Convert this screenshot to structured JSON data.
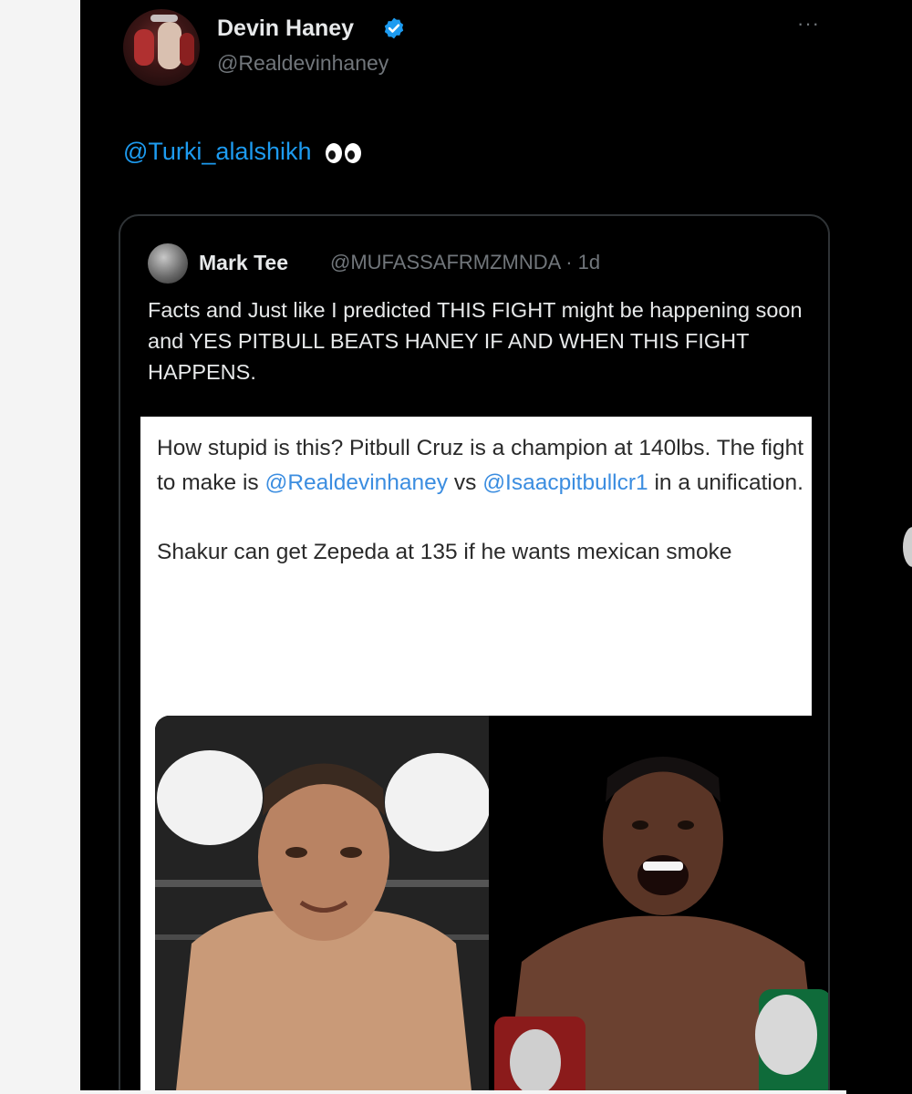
{
  "tweet": {
    "display_name": "Devin Haney",
    "handle": "@Realdevinhaney",
    "more_label": "···",
    "mention": "@Turki_alalshikh",
    "emoji_icon": "eyes-emoji"
  },
  "quote": {
    "name": "Mark Tee",
    "handle_time": "@MUFASSAFRMZMNDA · 1d",
    "text": "Facts and Just like I predicted THIS FIGHT might be happening soon and YES PITBULL BEATS HANEY IF AND WHEN THIS FIGHT HAPPENS."
  },
  "embedded": {
    "line1_before": "How stupid is this? Pitbull Cruz is a champion at 140lbs. The fight to make is ",
    "link1": "@Realdevinhaney",
    "between": " vs ",
    "link2": "@Isaacpitbullcr1",
    "line1_after": " in a unification.",
    "paragraph2": "Shakur can get Zepeda at 135 if he wants mexican smoke"
  },
  "colors": {
    "background": "#000000",
    "text": "#e7e9ea",
    "muted": "#71767b",
    "link": "#1d9bf0",
    "verified": "#1d9bf0"
  }
}
